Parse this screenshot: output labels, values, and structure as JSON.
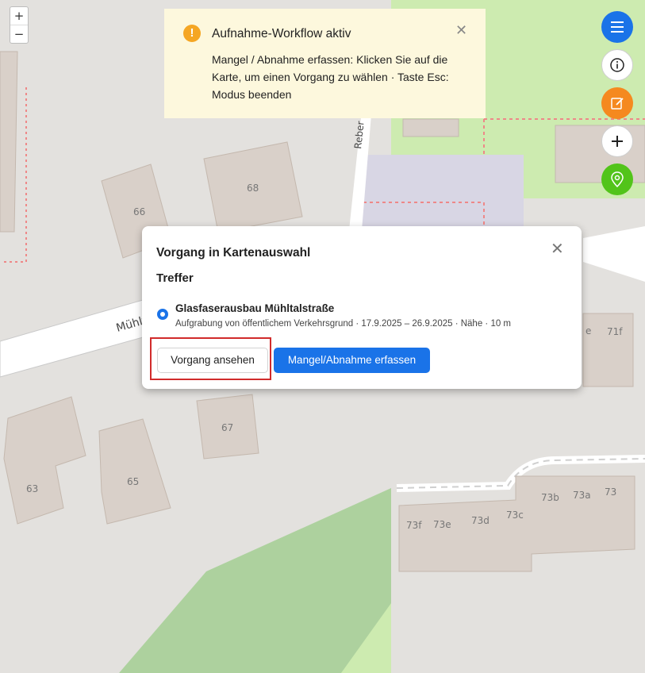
{
  "map": {
    "zoom_in": "+",
    "zoom_out": "−",
    "street_label_1": "Mühlt",
    "street_label_2": "Reber",
    "house_numbers": [
      "66",
      "68",
      "67",
      "63",
      "65",
      "71f",
      "e",
      "73b",
      "73a",
      "73",
      "73f",
      "73e",
      "73d",
      "73c"
    ],
    "colors": {
      "background": "#e3e1de",
      "building": "#d9d0c9",
      "forest": "#add19e",
      "grass": "#cdebb0"
    }
  },
  "banner": {
    "icon": "warning-icon",
    "icon_text": "!",
    "title": "Aufnahme-Workflow aktiv",
    "body": "Mangel / Abnahme erfassen: Klicken Sie auf die Karte, um einen Vorgang zu wählen · Taste Esc: Modus beenden",
    "close": "✕",
    "background": "#fdf8dd"
  },
  "fabs": [
    {
      "name": "menu-icon",
      "color": "#1a73e8"
    },
    {
      "name": "info-icon",
      "color": "#ffffff"
    },
    {
      "name": "edit-icon",
      "color": "#f5891f"
    },
    {
      "name": "plus-icon",
      "color": "#ffffff"
    },
    {
      "name": "location-pin-icon",
      "color": "#52c41a"
    }
  ],
  "dialog": {
    "title": "Vorgang in Kartenauswahl",
    "close": "✕",
    "subtitle": "Treffer",
    "result": {
      "title": "Glasfaserausbau Mühltalstraße",
      "meta": "Aufgrabung von öffentlichem Verkehrsgrund  ·  17.9.2025 – 26.9.2025  ·  Nähe · 10 m",
      "selected": true
    },
    "secondary_button": "Vorgang ansehen",
    "primary_button": "Mangel/Abnahme erfassen"
  }
}
